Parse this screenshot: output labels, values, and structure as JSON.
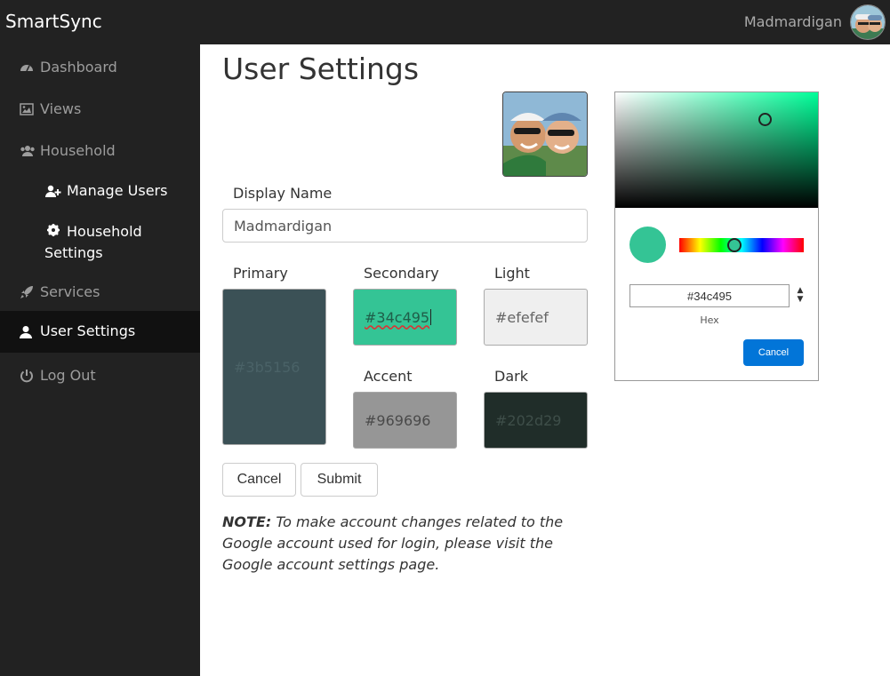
{
  "app": {
    "brand": "SmartSync",
    "user_name": "Madmardigan"
  },
  "sidebar": {
    "items": [
      {
        "label": "Dashboard",
        "icon": "dashboard-icon"
      },
      {
        "label": "Views",
        "icon": "image-icon"
      },
      {
        "label": "Household",
        "icon": "users-icon"
      },
      {
        "label": "Manage Users",
        "icon": "user-plus-icon"
      },
      {
        "label": "Household Settings",
        "icon": "gear-icon"
      },
      {
        "label": "Services",
        "icon": "rocket-icon"
      },
      {
        "label": "User Settings",
        "icon": "user-icon",
        "active": true
      },
      {
        "label": "Log Out",
        "icon": "power-icon"
      }
    ]
  },
  "main": {
    "title": "User Settings",
    "display_name": {
      "label": "Display Name",
      "value": "Madmardigan"
    },
    "colors": {
      "primary": {
        "label": "Primary",
        "value": "#3b5156",
        "bg": "#3b5156"
      },
      "secondary": {
        "label": "Secondary",
        "value": "#34c495",
        "bg": "#34c495"
      },
      "light": {
        "label": "Light",
        "value": "#efefef",
        "bg": "#efefef"
      },
      "accent": {
        "label": "Accent",
        "value": "#969696",
        "bg": "#969696"
      },
      "dark": {
        "label": "Dark",
        "value": "#202d29",
        "bg": "#202d29"
      }
    },
    "buttons": {
      "cancel": "Cancel",
      "submit": "Submit"
    },
    "note": {
      "prefix": "NOTE:",
      "text": " To make account changes related to the Google account used for login, please visit the Google account settings page."
    }
  },
  "color_picker": {
    "hex_value": "#34c495",
    "mode_label": "Hex",
    "cancel_label": "Cancel",
    "accent": "#0275d8"
  }
}
